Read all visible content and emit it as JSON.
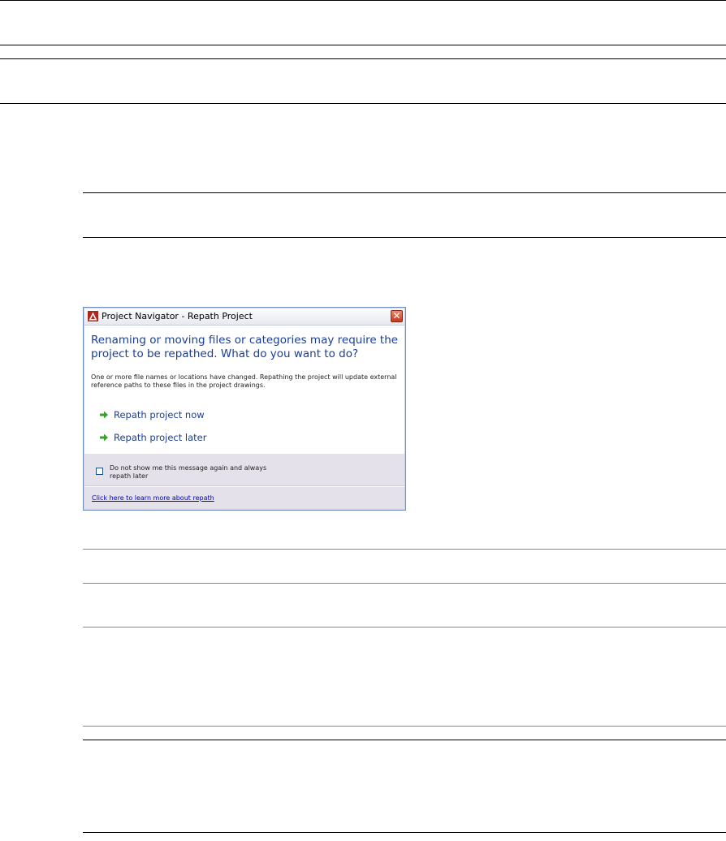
{
  "dialog": {
    "title": "Project Navigator - Repath Project",
    "heading": "Renaming or moving files or categories may require the project to be repathed. What do you want to do?",
    "description": "One or more file names or locations have changed. Repathing the project will update external reference paths to these files in the project drawings.",
    "options": [
      {
        "label": "Repath project now"
      },
      {
        "label": "Repath project later"
      }
    ],
    "checkbox": {
      "label": "Do not show me this message again and always repath later",
      "checked": false
    },
    "learn_more_link": "Click here to learn more about repath",
    "close_symbol": "✕"
  },
  "colors": {
    "heading": "#1a3e96",
    "arrow": "#3aa12c",
    "footer_bg": "#e4e1ea",
    "link": "#0000d0"
  }
}
